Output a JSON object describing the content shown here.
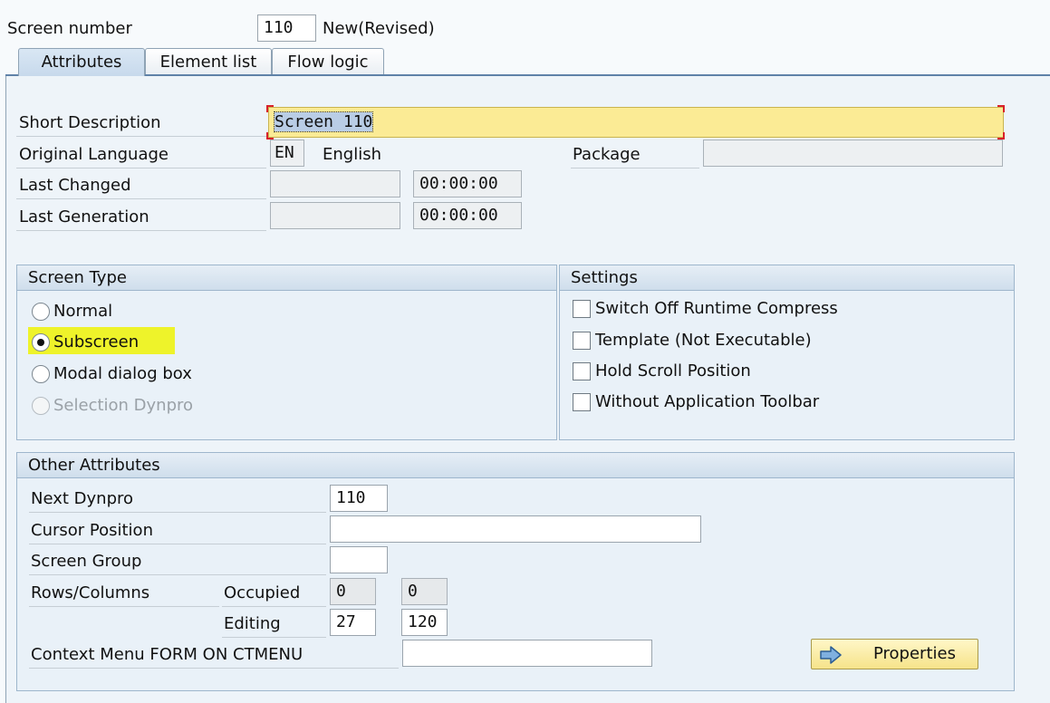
{
  "header": {
    "screen_number_label": "Screen number",
    "screen_number": "110",
    "status": "New(Revised)"
  },
  "tabs": [
    {
      "label": "Attributes",
      "active": true
    },
    {
      "label": "Element list",
      "active": false
    },
    {
      "label": "Flow logic",
      "active": false
    }
  ],
  "attributes": {
    "short_description_label": "Short Description",
    "short_description": "Screen 110",
    "original_language_label": "Original Language",
    "language_code": "EN",
    "language_name": "English",
    "package_label": "Package",
    "package": "",
    "last_changed_label": "Last Changed",
    "last_changed_date": "",
    "last_changed_time": "00:00:00",
    "last_generation_label": "Last Generation",
    "last_generation_date": "",
    "last_generation_time": "00:00:00"
  },
  "screen_type": {
    "title": "Screen Type",
    "options": [
      {
        "label": "Normal",
        "selected": false,
        "disabled": false
      },
      {
        "label": "Subscreen",
        "selected": true,
        "disabled": false
      },
      {
        "label": "Modal dialog box",
        "selected": false,
        "disabled": false
      },
      {
        "label": "Selection Dynpro",
        "selected": false,
        "disabled": true
      }
    ],
    "highlight_color": "#eef32a"
  },
  "settings": {
    "title": "Settings",
    "options": [
      {
        "label": "Switch Off Runtime Compress",
        "checked": false
      },
      {
        "label": "Template (Not Executable)",
        "checked": false
      },
      {
        "label": "Hold Scroll Position",
        "checked": false
      },
      {
        "label": "Without Application Toolbar",
        "checked": false
      }
    ]
  },
  "other": {
    "title": "Other Attributes",
    "next_dynpro_label": "Next Dynpro",
    "next_dynpro": "110",
    "cursor_position_label": "Cursor Position",
    "cursor_position": "",
    "screen_group_label": "Screen Group",
    "screen_group": "",
    "rows_columns_label": "Rows/Columns",
    "occupied_label": "Occupied",
    "occupied_rows": "0",
    "occupied_cols": "0",
    "editing_label": "Editing",
    "editing_rows": "27",
    "editing_cols": "120",
    "context_menu_label": "Context Menu FORM ON CTMENU",
    "context_menu": "",
    "properties_button": "Properties",
    "properties_icon": "arrow-right-icon"
  },
  "colors": {
    "highlight_yellow": "#eef32a",
    "description_field": "#fbeb95",
    "accent_blue": "#5f82a8"
  }
}
